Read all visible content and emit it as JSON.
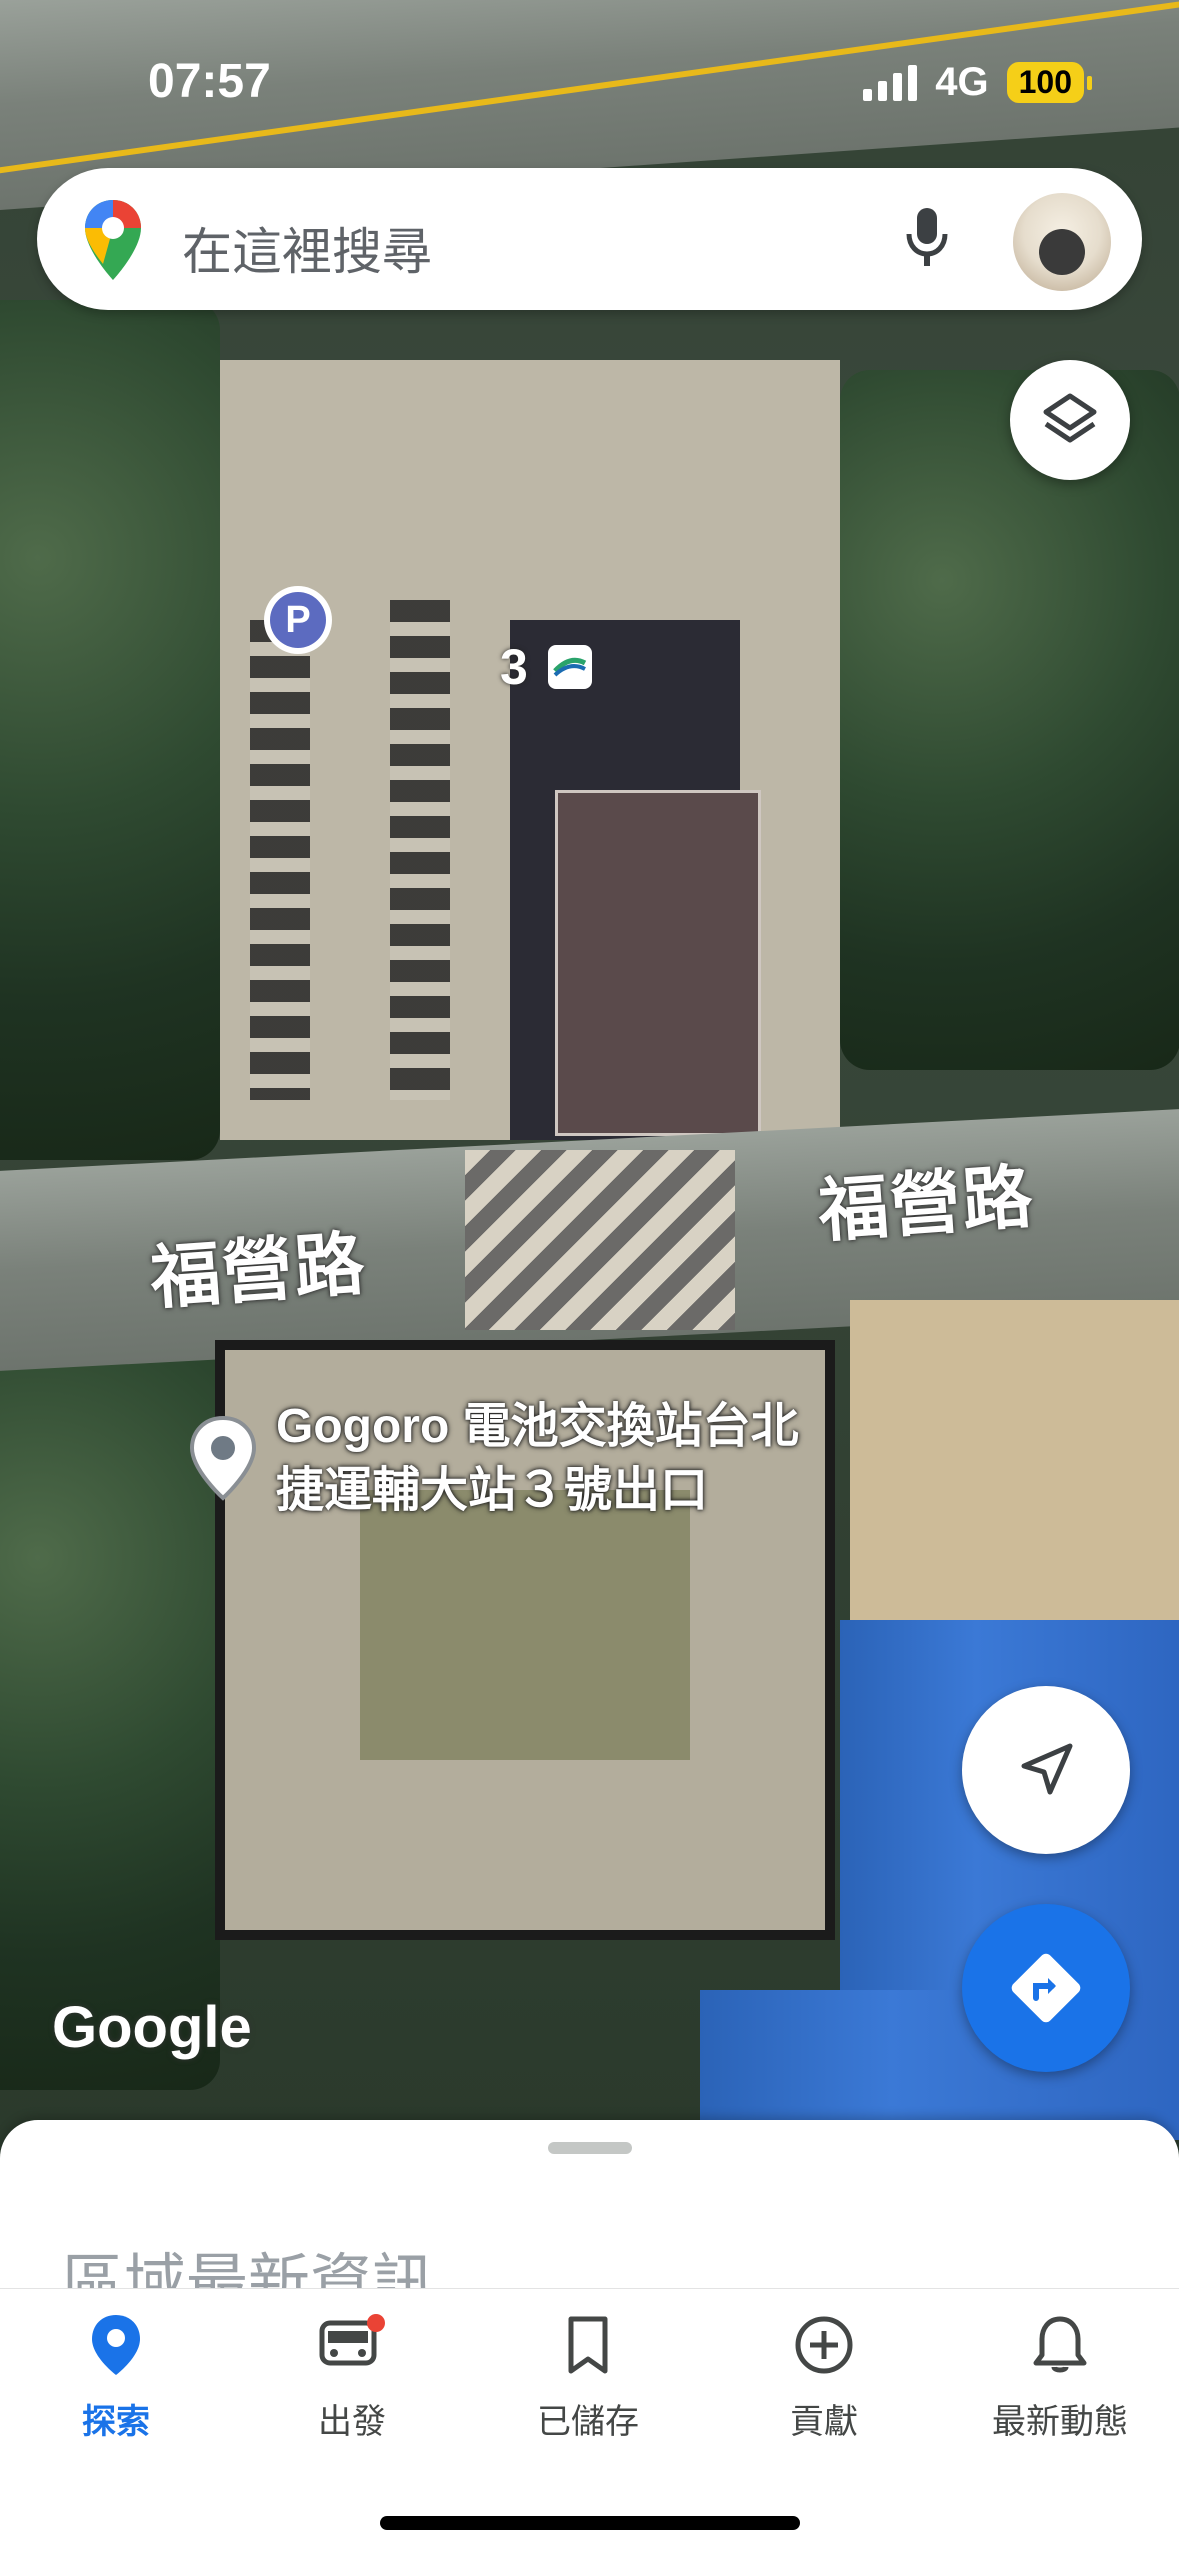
{
  "status_bar": {
    "time": "07:57",
    "network": "4G",
    "battery": "100"
  },
  "search": {
    "placeholder": "在這裡搜尋"
  },
  "map": {
    "road_labels": [
      "福營路",
      "福營路"
    ],
    "place_name_line1": "Gogoro 電池交換站台北",
    "place_name_line2": "捷運輔大站３號出口",
    "metro_exit_number": "3",
    "parking_marker": "P",
    "attribution": "Google"
  },
  "sheet": {
    "title": "區域最新資訊..."
  },
  "tabs": [
    {
      "label": "探索",
      "icon": "location-pin-icon",
      "active": true
    },
    {
      "label": "出發",
      "icon": "commute-icon",
      "active": false
    },
    {
      "label": "已儲存",
      "icon": "bookmark-icon",
      "active": false
    },
    {
      "label": "貢獻",
      "icon": "add-circle-icon",
      "active": false
    },
    {
      "label": "最新動態",
      "icon": "bell-icon",
      "active": false
    }
  ],
  "colors": {
    "accent": "#1a73e8",
    "battery": "#f5cf18",
    "badge": "#ea4335"
  }
}
